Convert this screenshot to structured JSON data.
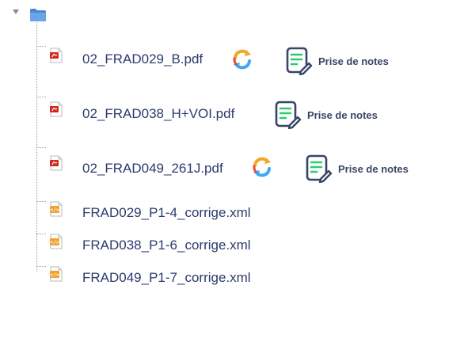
{
  "tree": {
    "root": {
      "expanded": true,
      "icon": "folder-icon"
    },
    "files": [
      {
        "name": "02_FRAD029_B.pdf",
        "type": "pdf",
        "has_sync": true,
        "has_notes": true
      },
      {
        "name": "02_FRAD038_H+VOI.pdf",
        "type": "pdf",
        "has_sync": false,
        "has_notes": true
      },
      {
        "name": "02_FRAD049_261J.pdf",
        "type": "pdf",
        "has_sync": true,
        "has_notes": true
      },
      {
        "name": "FRAD029_P1-4_corrige.xml",
        "type": "xml",
        "has_sync": false,
        "has_notes": false
      },
      {
        "name": "FRAD038_P1-6_corrige.xml",
        "type": "xml",
        "has_sync": false,
        "has_notes": false
      },
      {
        "name": "FRAD049_P1-7_corrige.xml",
        "type": "xml",
        "has_sync": false,
        "has_notes": false
      }
    ]
  },
  "actions": {
    "notes_label": "Prise de notes"
  },
  "colors": {
    "filename": "#2c3a6e",
    "notes_green": "#2ecc71",
    "notes_dark": "#3a4466",
    "sync_orange": "#f5a623",
    "sync_blue": "#3fa9f5",
    "sync_red": "#e74c3c",
    "pdf_red": "#d0281c"
  }
}
